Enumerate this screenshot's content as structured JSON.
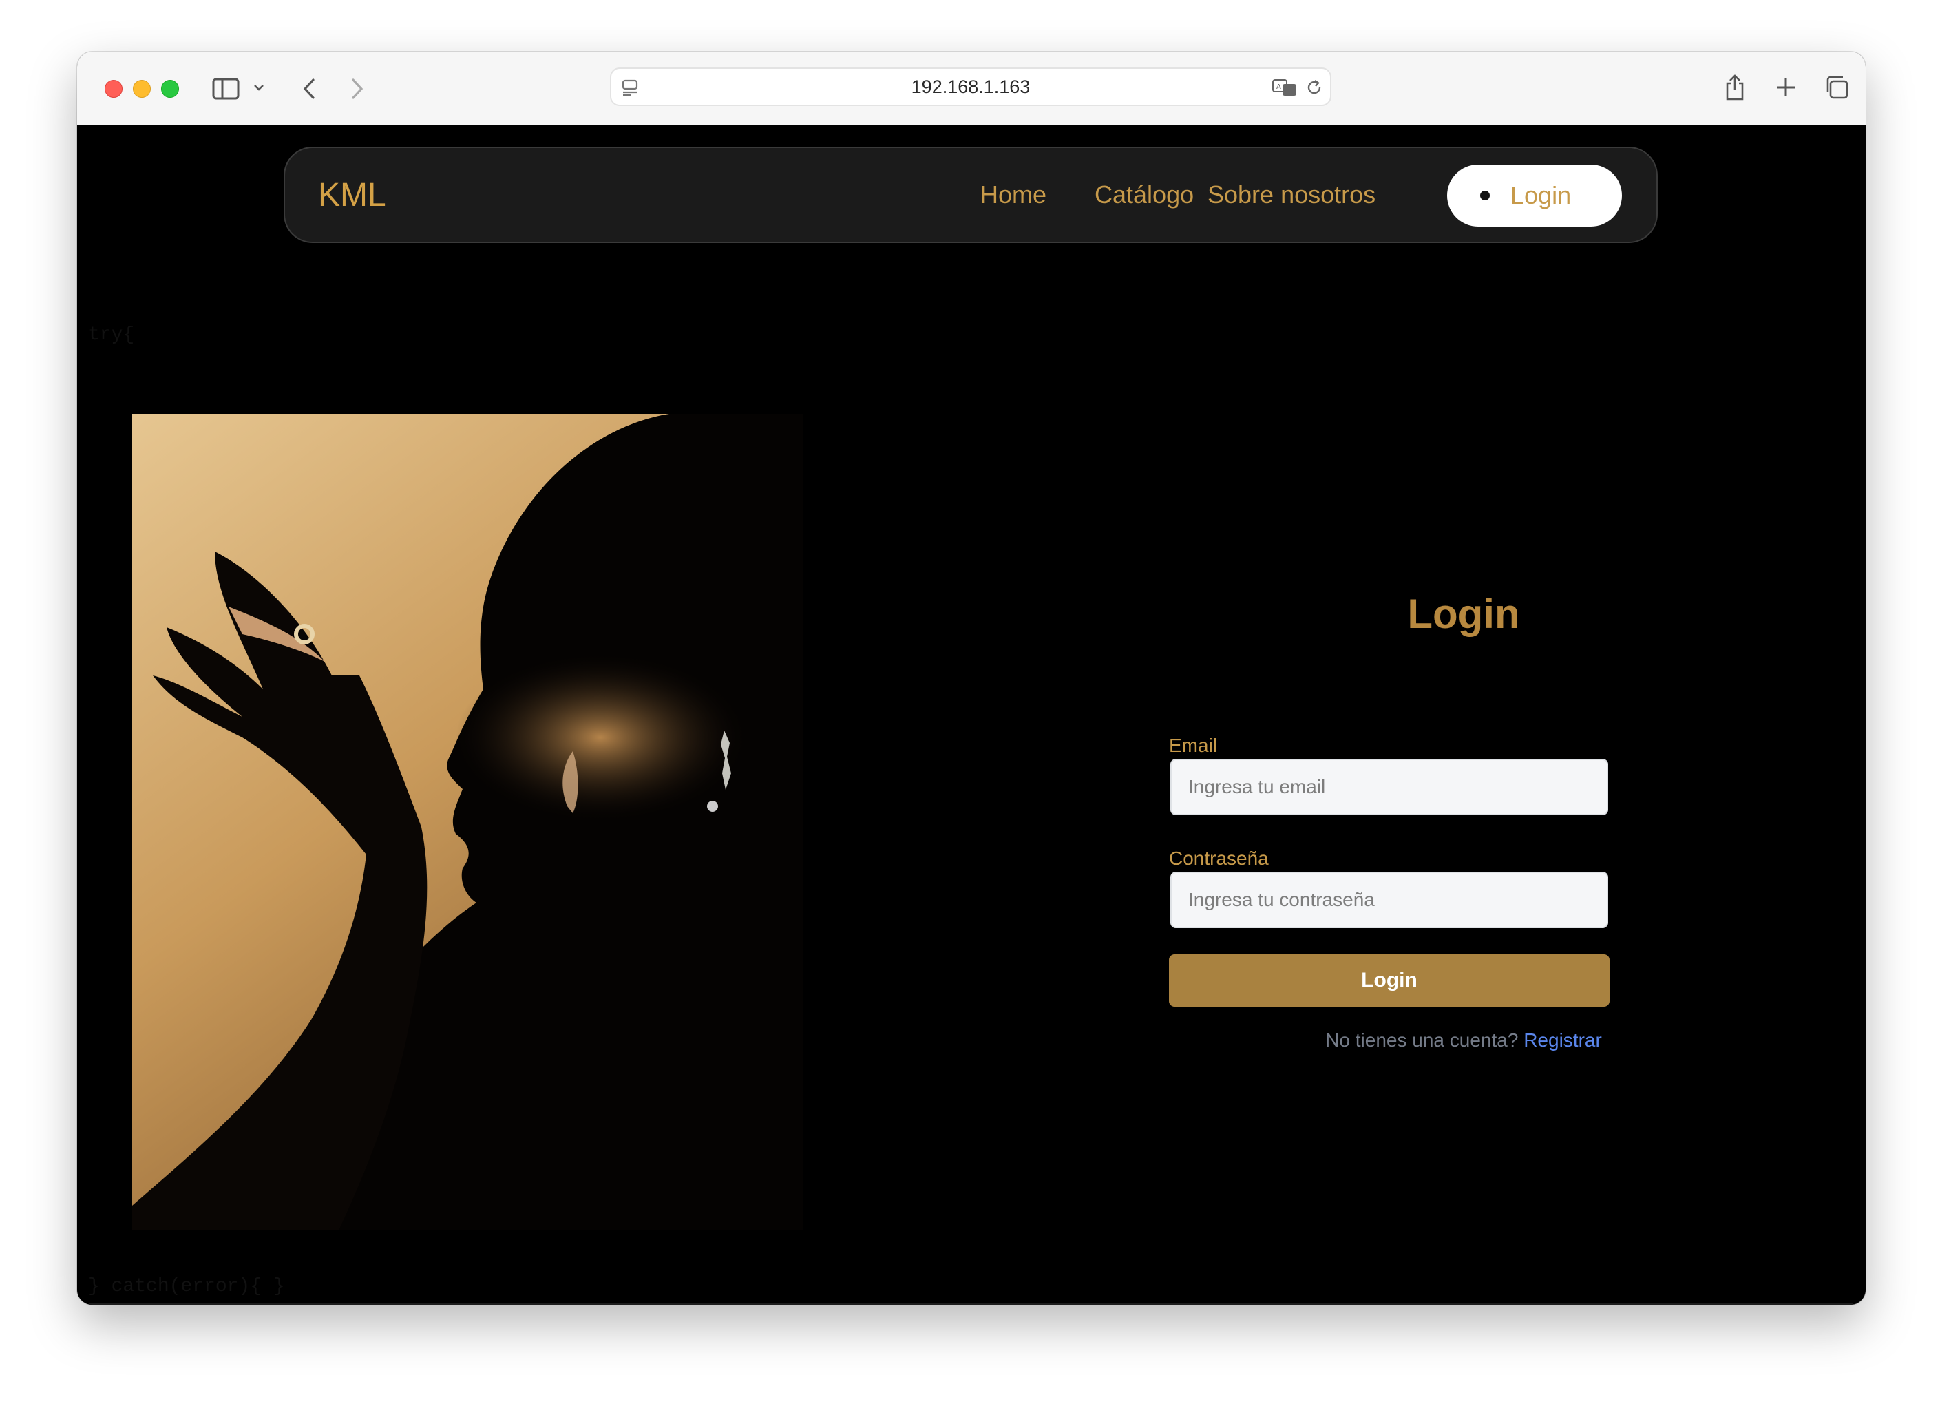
{
  "browser": {
    "url": "192.168.1.163",
    "icons": [
      "sidebar-icon",
      "chevron-down-icon",
      "back-icon",
      "forward-icon",
      "page-settings-icon",
      "translate-icon",
      "reload-icon",
      "share-icon",
      "new-tab-icon",
      "tab-overview-icon"
    ]
  },
  "nav": {
    "brand": "KML",
    "links": [
      "Home",
      "Catálogo",
      "Sobre nosotros"
    ],
    "login": "Login"
  },
  "debug": {
    "top": "try{",
    "bottom": "} catch(error){ }"
  },
  "form": {
    "title": "Login",
    "email_label": "Email",
    "email_placeholder": "Ingresa tu email",
    "password_label": "Contraseña",
    "password_placeholder": "Ingresa tu contraseña",
    "submit": "Login",
    "register_prompt": "No tienes una cuenta?",
    "register_link": "Registrar"
  },
  "colors": {
    "accent_gold": "#c79a4a",
    "button_gold": "#a98240",
    "link_blue": "#5a86ec"
  }
}
